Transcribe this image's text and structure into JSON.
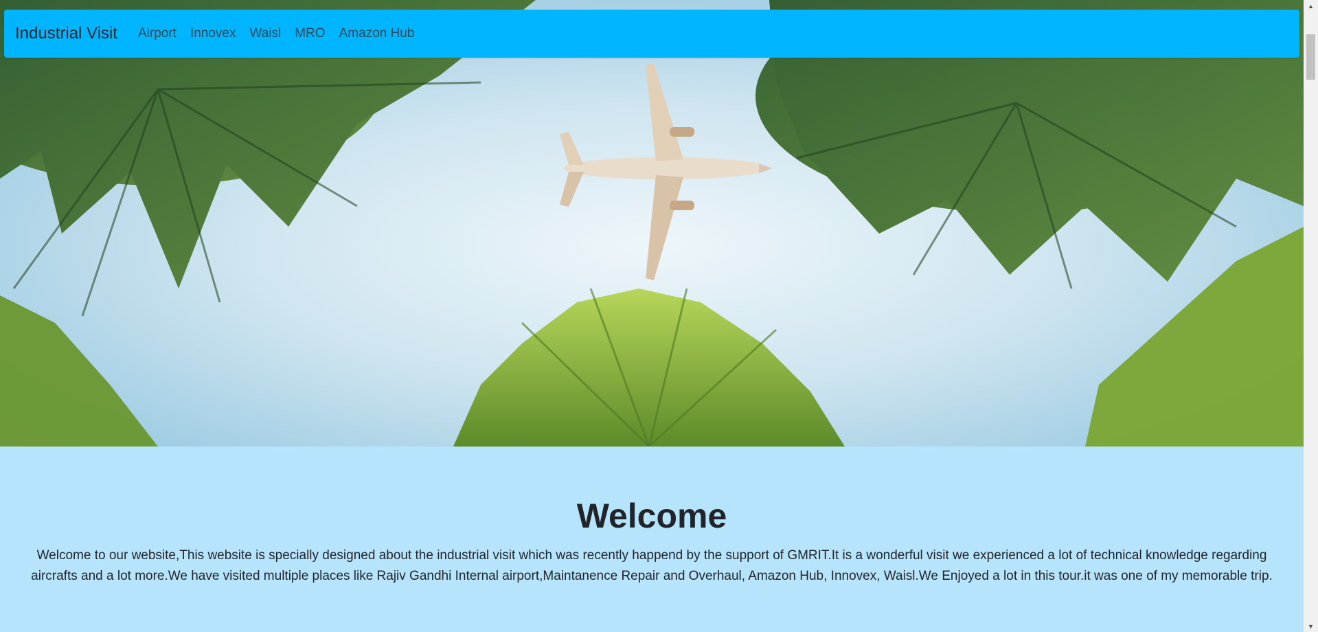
{
  "navbar": {
    "brand": "Industrial Visit",
    "links": [
      "Airport",
      "Innovex",
      "Waisl",
      "MRO",
      "Amazon Hub"
    ],
    "background_color": "#00b5ff"
  },
  "hero": {
    "image_description_icon": "airplane-over-palm-trees-image"
  },
  "welcome": {
    "title": "Welcome",
    "text": "Welcome to our website,This website is specially designed about the industrial visit which was recently happend by the support of GMRIT.It is a wonderful visit we experienced a lot of technical knowledge regarding aircrafts and a lot more.We have visited multiple places like Rajiv Gandhi Internal airport,Maintanence Repair and Overhaul, Amazon Hub, Innovex, Waisl.We Enjoyed a lot in this tour.it was one of my memorable trip.",
    "background_color": "#b6e4fc"
  },
  "scrollbar": {
    "up_icon": "scroll-up-arrow-icon",
    "down_icon": "scroll-down-arrow-icon"
  }
}
